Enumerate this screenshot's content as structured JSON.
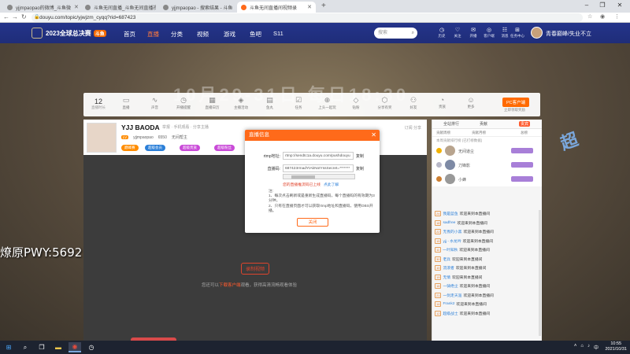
{
  "browser": {
    "tabs": [
      {
        "title": "yjjmpaopao的微博_斗鱼微"
      },
      {
        "title": "斗鱼无间直播_斗鱼无间直播视频"
      },
      {
        "title": "yjjmpaopao - 搜索结果 - 斗鱼"
      },
      {
        "title": "斗鱼无间直播间视频录"
      }
    ],
    "new_tab": "+",
    "url": "douyu.com/topic/yjwjzm_cyqq?rid=687423"
  },
  "header": {
    "logo_text": "2023全球总决赛",
    "logo_badge": "斗鱼",
    "nav": [
      "首页",
      "直播",
      "分类",
      "视频",
      "游戏",
      "鱼吧",
      "S11"
    ],
    "search_placeholder": "搜索",
    "icons": [
      {
        "glyph": "◷",
        "label": "历史"
      },
      {
        "glyph": "♡",
        "label": "关注"
      },
      {
        "glyph": "✉",
        "label": "开播"
      },
      {
        "glyph": "◎",
        "label": "客户端"
      },
      {
        "glyph": "☷",
        "label": "消息"
      },
      {
        "glyph": "▣",
        "label": "斗鱼"
      },
      {
        "glyph": "⊞",
        "label": "任务中心"
      }
    ],
    "username": "青春巅峰/失业不立"
  },
  "background": {
    "big_text": "10月29-31日 每日18:30"
  },
  "category_bar": {
    "count": "12",
    "count_label": "直播时长",
    "items": [
      {
        "glyph": "▭",
        "label": "直播"
      },
      {
        "glyph": "∿",
        "label": "声音"
      },
      {
        "glyph": "◷",
        "label": "开播提醒"
      },
      {
        "glyph": "▦",
        "label": "直播日历"
      },
      {
        "glyph": "◈",
        "label": "主播活动"
      },
      {
        "glyph": "▤",
        "label": "鱼丸"
      },
      {
        "glyph": "☑",
        "label": "任务"
      },
      {
        "glyph": "⊕",
        "label": "上头一起玩"
      },
      {
        "glyph": "◇",
        "label": "钻粉"
      },
      {
        "glyph": "⬡",
        "label": "分享有奖"
      },
      {
        "glyph": "⚇",
        "label": "好友"
      },
      {
        "glyph": "◔",
        "label": "贵族"
      },
      {
        "glyph": "☺",
        "label": "更多"
      }
    ],
    "pc_button": "PC客户端",
    "pc_sub": "立即领取奖励"
  },
  "streamer": {
    "name": "YJJ BAODA",
    "info": "举报 · 手机观看 · 分享主播",
    "level": "LV",
    "uid": "yjjmpaopao",
    "room": "6550",
    "line2_extra": "无间帮主",
    "chips": [
      "巅峰赛",
      "超级会员",
      "超级贵族",
      "超级粉丝"
    ],
    "report": "分享",
    "subscribe": "订阅 分享"
  },
  "player": {
    "record_button": "录制视频",
    "tip_prefix": "您还可以",
    "tip_link": "下载客户端",
    "tip_suffix": "观看，获得高清流畅观看体验"
  },
  "overlay": {
    "text": "燎原PWY:5692"
  },
  "chat": {
    "tabs": [
      "全站排行",
      "贡献",
      "贵宾"
    ],
    "hot_tab": "贵宾",
    "rank_tabs": [
      "贡献周榜",
      "贡献月榜",
      "总榜"
    ],
    "rank_header": "本周贡献排行榜 (已打榜数据)",
    "rank_rows": [
      {
        "name": "无间道尘"
      },
      {
        "name": "刀锋影"
      },
      {
        "name": "小蜂"
      }
    ],
    "messages": [
      {
        "lv": "24",
        "user": "我是蓝鱼",
        "text": "欢迎来到本直播间"
      },
      {
        "lv": "18",
        "user": "sadfree",
        "text": "欢迎来到本直播间"
      },
      {
        "lv": "22",
        "user": "无畏的小黑",
        "text": "欢迎来到本直播间"
      },
      {
        "lv": "15",
        "user": "yjj - 水龙吟",
        "text": "欢迎来到本直播间"
      },
      {
        "lv": "11",
        "user": "一叶知秋",
        "text": "欢迎来到本直播间"
      },
      {
        "lv": "30",
        "user": "老兵",
        "text": "欢迎来到本直播间"
      },
      {
        "lv": "10",
        "user": "流浪者",
        "text": "欢迎来到本直播间"
      },
      {
        "lv": "19",
        "user": "无情",
        "text": "欢迎来到本直播间"
      },
      {
        "lv": "16",
        "user": "一骑绝尘",
        "text": "欢迎来到本直播间"
      },
      {
        "lv": "21",
        "user": "一剑走天涯",
        "text": "欢迎来到本直播间"
      },
      {
        "lv": "14",
        "user": "Frank2",
        "text": "欢迎来到本直播间"
      },
      {
        "lv": "12",
        "user": "超级战士",
        "text": "欢迎来到本直播间"
      }
    ]
  },
  "modal": {
    "title": "直播信息",
    "close_glyph": "✕",
    "rtmp_label": "rtmp地址:",
    "rtmp_value": "rtmp://sendtc1a.douyu.com/pushdouyu",
    "copy": "复制",
    "key_label": "直播码:",
    "key_value": "687423rmadYtAkNotYssSecret=*******",
    "warning": "您的直播推流码已上线",
    "warning_link": "点此了解",
    "notes": [
      "注:",
      "1、每次点击刷新或是重新生成直播码，每个直播码的有效期为3分钟。",
      "2、只有在直播页面才可以获取rtmp地址和直播码，使用OBS开播。"
    ],
    "close_button": "关闭"
  },
  "taskbar": {
    "time": "10:55",
    "date": "2021/10/31"
  },
  "colors": {
    "accent": "#ff6a1a",
    "header_bg": "#1f2d79"
  }
}
